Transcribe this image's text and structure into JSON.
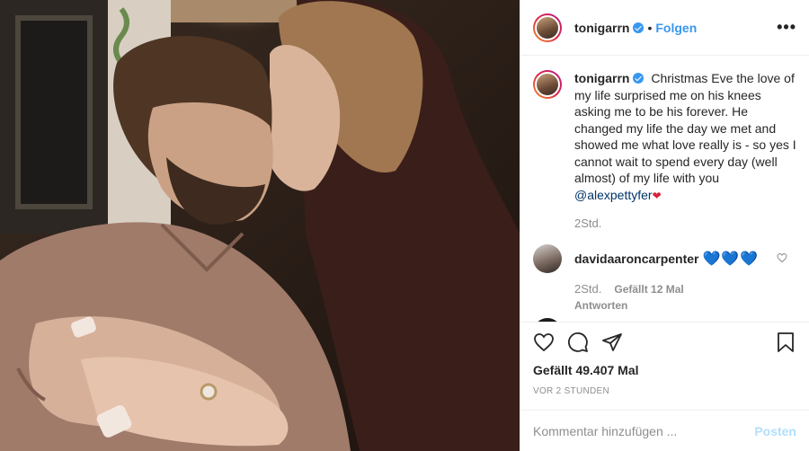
{
  "header": {
    "username": "tonigarrn",
    "separator": "•",
    "follow_label": "Folgen",
    "more_label": "•••"
  },
  "caption": {
    "username": "tonigarrn",
    "text": "Christmas Eve the love of my life surprised me on his knees asking me to be his forever. He changed my life the day we met and showed me what love really is - so yes I cannot wait to spend every day (well almost) of my life with you",
    "mention": "@alexpettyfer",
    "heart": "❤",
    "time": "2Std."
  },
  "comment": {
    "username": "davidaaroncarpenter",
    "hearts": "💙💙💙",
    "time": "2Std.",
    "likes": "Gefällt 12 Mal",
    "reply": "Antworten"
  },
  "stats": {
    "likes": "Gefällt 49.407 Mal",
    "posted": "VOR 2 STUNDEN"
  },
  "add_comment": {
    "placeholder": "Kommentar hinzufügen ...",
    "post_label": "Posten"
  },
  "icons": {
    "verified": "verified-badge-icon",
    "like": "heart-icon",
    "comment": "comment-icon",
    "share": "paper-plane-icon",
    "save": "bookmark-icon"
  },
  "colors": {
    "accent": "#3897f0",
    "muted": "#8e8e8e",
    "post_disabled": "#b2dffc"
  }
}
